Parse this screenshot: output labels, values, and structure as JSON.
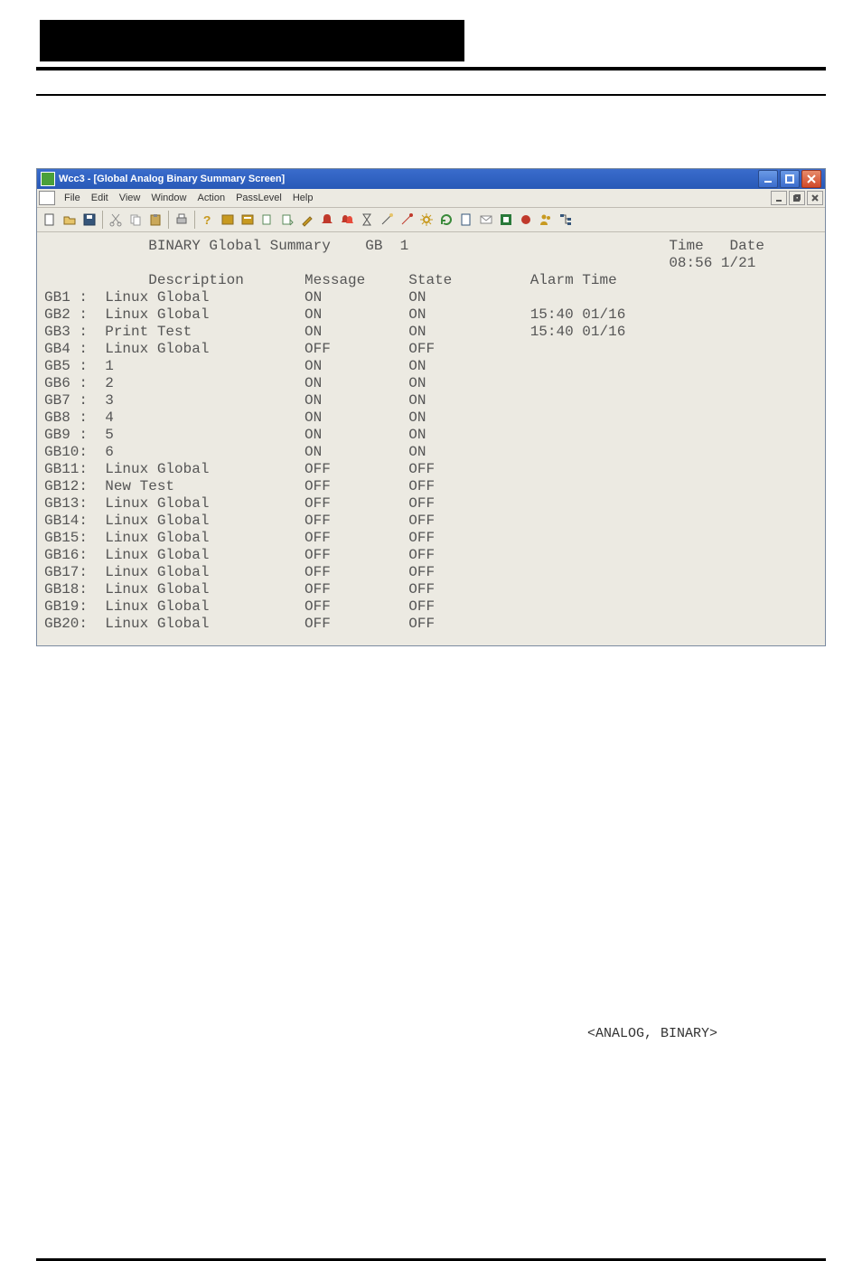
{
  "window": {
    "title": "Wcc3 - [Global Analog Binary Summary Screen]",
    "controls": [
      "minimize",
      "maximize",
      "close"
    ]
  },
  "menubar": {
    "items": [
      "File",
      "Edit",
      "View",
      "Window",
      "Action",
      "PassLevel",
      "Help"
    ],
    "mdi_controls": [
      "minimize",
      "restore",
      "close"
    ]
  },
  "toolbar_icons": [
    "new-icon",
    "open-icon",
    "save-icon",
    "sep",
    "cut-icon",
    "copy-icon",
    "paste-icon",
    "sep",
    "print-icon",
    "sep",
    "help-one-icon",
    "help-all-icon",
    "help-topic-icon",
    "copy-doc-icon",
    "paste-doc-icon",
    "brush-icon",
    "bell-icon",
    "bells-icon",
    "hourglass-icon",
    "wand-icon",
    "wand2-icon",
    "gear-icon",
    "refresh-icon",
    "doc-icon",
    "mail-icon",
    "stop-icon",
    "record-icon",
    "people-icon",
    "tree-icon"
  ],
  "header": {
    "screen_title": "BINARY Global Summary",
    "code": "GB",
    "page_num": "1",
    "time_label": "Time",
    "date_label": "Date",
    "time": "08:56",
    "date": "1/21"
  },
  "columns": {
    "description": "Description",
    "message": "Message",
    "state": "State",
    "alarm_time": "Alarm Time"
  },
  "rows": [
    {
      "id": "GB1 ",
      "desc": "Linux Global",
      "msg": "ON",
      "state": "ON",
      "alarm": ""
    },
    {
      "id": "GB2 ",
      "desc": "Linux Global",
      "msg": "ON",
      "state": "ON",
      "alarm": "15:40 01/16"
    },
    {
      "id": "GB3 ",
      "desc": "Print Test",
      "msg": "ON",
      "state": "ON",
      "alarm": "15:40 01/16"
    },
    {
      "id": "GB4 ",
      "desc": "Linux Global",
      "msg": "OFF",
      "state": "OFF",
      "alarm": ""
    },
    {
      "id": "GB5 ",
      "desc": "1",
      "msg": "ON",
      "state": "ON",
      "alarm": ""
    },
    {
      "id": "GB6 ",
      "desc": "2",
      "msg": "ON",
      "state": "ON",
      "alarm": ""
    },
    {
      "id": "GB7 ",
      "desc": "3",
      "msg": "ON",
      "state": "ON",
      "alarm": ""
    },
    {
      "id": "GB8 ",
      "desc": "4",
      "msg": "ON",
      "state": "ON",
      "alarm": ""
    },
    {
      "id": "GB9 ",
      "desc": "5",
      "msg": "ON",
      "state": "ON",
      "alarm": ""
    },
    {
      "id": "GB10",
      "desc": "6",
      "msg": "ON",
      "state": "ON",
      "alarm": ""
    },
    {
      "id": "GB11",
      "desc": "Linux Global",
      "msg": "OFF",
      "state": "OFF",
      "alarm": ""
    },
    {
      "id": "GB12",
      "desc": "New Test",
      "msg": "OFF",
      "state": "OFF",
      "alarm": ""
    },
    {
      "id": "GB13",
      "desc": "Linux Global",
      "msg": "OFF",
      "state": "OFF",
      "alarm": ""
    },
    {
      "id": "GB14",
      "desc": "Linux Global",
      "msg": "OFF",
      "state": "OFF",
      "alarm": ""
    },
    {
      "id": "GB15",
      "desc": "Linux Global",
      "msg": "OFF",
      "state": "OFF",
      "alarm": ""
    },
    {
      "id": "GB16",
      "desc": "Linux Global",
      "msg": "OFF",
      "state": "OFF",
      "alarm": ""
    },
    {
      "id": "GB17",
      "desc": "Linux Global",
      "msg": "OFF",
      "state": "OFF",
      "alarm": ""
    },
    {
      "id": "GB18",
      "desc": "Linux Global",
      "msg": "OFF",
      "state": "OFF",
      "alarm": ""
    },
    {
      "id": "GB19",
      "desc": "Linux Global",
      "msg": "OFF",
      "state": "OFF",
      "alarm": ""
    },
    {
      "id": "GB20",
      "desc": "Linux Global",
      "msg": "OFF",
      "state": "OFF",
      "alarm": ""
    }
  ],
  "footer_inline": "<ANALOG, BINARY>"
}
